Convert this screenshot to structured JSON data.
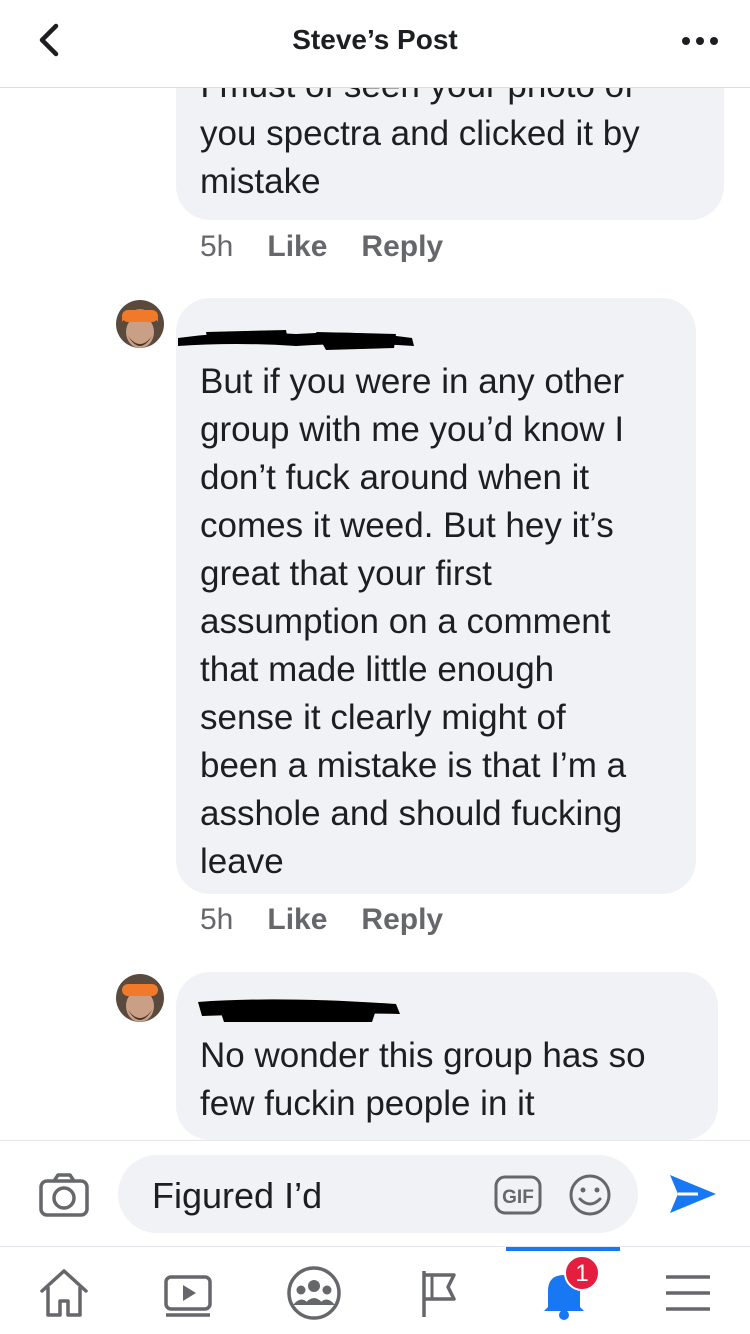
{
  "header": {
    "title": "Steve’s Post",
    "back_icon": "chevron-left-icon",
    "more_icon": "more-icon"
  },
  "comments": [
    {
      "text": "I must of seen your photo of\nyou spectra and clicked it by\nmistake",
      "time": "5h",
      "like": "Like",
      "reply": "Reply"
    },
    {
      "text": "But if you were in any other\ngroup with me you’d know I\ndon’t fuck around when it\ncomes it weed. But hey it’s\ngreat that your first\nassumption on a comment\nthat made little enough\nsense it clearly might of\nbeen a mistake is that I’m a\nasshole and should fucking\nleave",
      "time": "5h",
      "like": "Like",
      "reply": "Reply"
    },
    {
      "text": "No wonder this group has so\nfew fuckin people in it"
    }
  ],
  "composer": {
    "value": "Figured I’d",
    "gif_label": "GIF"
  },
  "nav": {
    "notification_count": "1"
  },
  "colors": {
    "accent": "#1877f2",
    "bubble": "#f0f2f5",
    "badge": "#e41e3f"
  }
}
